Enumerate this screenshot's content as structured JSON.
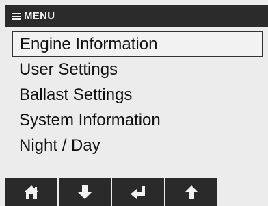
{
  "header": {
    "title": "MENU",
    "icon": "hamburger-menu-icon"
  },
  "menu": {
    "items": [
      {
        "label": "Engine Information",
        "selected": true
      },
      {
        "label": "User Settings",
        "selected": false
      },
      {
        "label": "Ballast Settings",
        "selected": false
      },
      {
        "label": "System Information",
        "selected": false
      },
      {
        "label": "Night / Day",
        "selected": false
      }
    ]
  },
  "toolbar": {
    "buttons": [
      {
        "icon": "home-icon"
      },
      {
        "icon": "arrow-down-icon"
      },
      {
        "icon": "enter-icon"
      },
      {
        "icon": "arrow-up-icon"
      }
    ]
  },
  "colors": {
    "background": "#ececec",
    "header": "#2b2b2b",
    "toolbar": "#2a2a2a",
    "text": "#111111",
    "header_text": "#f2f2f2"
  }
}
